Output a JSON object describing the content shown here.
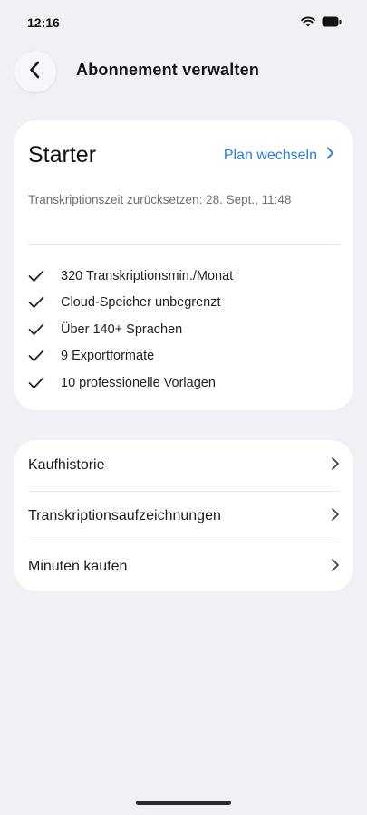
{
  "status_bar": {
    "time": "12:16"
  },
  "header": {
    "title": "Abonnement verwalten"
  },
  "plan": {
    "name": "Starter",
    "change_label": "Plan wechseln",
    "reset_text": "Transkriptionszeit zurücksetzen:  28. Sept., 11:48",
    "features": [
      "320 Transkriptionsmin./Monat",
      "Cloud-Speicher unbegrenzt",
      "Über 140+ Sprachen",
      "9 Exportformate",
      "10 professionelle Vorlagen"
    ]
  },
  "links": [
    {
      "label": "Kaufhistorie"
    },
    {
      "label": "Transkriptionsaufzeichnungen"
    },
    {
      "label": "Minuten kaufen"
    }
  ],
  "colors": {
    "accent": "#2b7de9",
    "background": "#f0f1f5",
    "card": "#ffffff"
  }
}
